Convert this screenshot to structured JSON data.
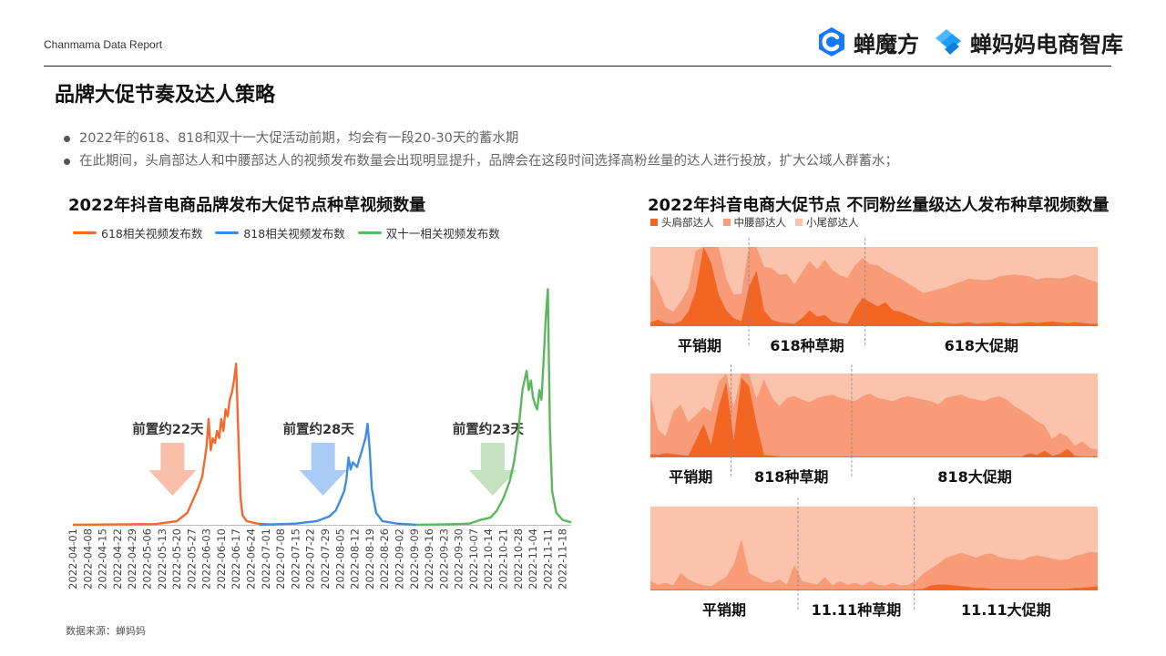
{
  "header": {
    "report_name": "Chanmama Data Report"
  },
  "logos": {
    "brand1": "蝉魔方",
    "brand2": "蝉妈妈电商智库",
    "brand1_color": "#1677ff",
    "brand2_color": "#1a9fff"
  },
  "page": {
    "title": "品牌大促节奏及达人策略"
  },
  "bullets": [
    "2022年的618、818和双十一大促活动前期，均会有一段20-30天的蓄水期",
    "在此期间，头肩部达人和中腰部达人的视频发布数量会出现明显提升，品牌会在这段时间选择高粉丝量的达人进行投放，扩大公域人群蓄水；"
  ],
  "source": "数据来源：蝉妈妈",
  "chart_data": [
    {
      "type": "line",
      "title": "2022年抖音电商品牌发布大促节点种草视频数量",
      "x_tick_labels": [
        "2022-04-01",
        "2022-04-08",
        "2022-04-15",
        "2022-04-22",
        "2022-04-29",
        "2022-05-06",
        "2022-05-13",
        "2022-05-20",
        "2022-05-27",
        "2022-06-03",
        "2022-06-10",
        "2022-06-17",
        "2022-06-24",
        "2022-07-01",
        "2022-07-08",
        "2022-07-15",
        "2022-07-22",
        "2022-07-29",
        "2022-08-05",
        "2022-08-12",
        "2022-08-19",
        "2022-08-26",
        "2022-09-02",
        "2022-09-09",
        "2022-09-16",
        "2022-09-23",
        "2022-09-30",
        "2022-10-07",
        "2022-10-14",
        "2022-10-21",
        "2022-10-28",
        "2022-11-04",
        "2022-11-11",
        "2022-11-18"
      ],
      "x_range": [
        "2022-04-01",
        "2022-11-22"
      ],
      "y_range": [
        0,
        100
      ],
      "series": [
        {
          "name": "618相关视频发布数",
          "color": "#f26b2e",
          "points": [
            [
              "2022-04-01",
              0
            ],
            [
              "2022-05-10",
              0.3
            ],
            [
              "2022-05-20",
              1.5
            ],
            [
              "2022-05-25",
              5
            ],
            [
              "2022-05-30",
              15
            ],
            [
              "2022-06-01",
              20
            ],
            [
              "2022-06-03",
              32
            ],
            [
              "2022-06-04",
              44
            ],
            [
              "2022-06-05",
              31
            ],
            [
              "2022-06-06",
              36
            ],
            [
              "2022-06-07",
              34
            ],
            [
              "2022-06-08",
              39
            ],
            [
              "2022-06-09",
              36
            ],
            [
              "2022-06-10",
              44
            ],
            [
              "2022-06-11",
              39
            ],
            [
              "2022-06-12",
              48
            ],
            [
              "2022-06-13",
              45
            ],
            [
              "2022-06-14",
              52
            ],
            [
              "2022-06-15",
              55
            ],
            [
              "2022-06-16",
              60
            ],
            [
              "2022-06-17",
              67
            ],
            [
              "2022-06-18",
              38
            ],
            [
              "2022-06-19",
              12
            ],
            [
              "2022-06-20",
              4
            ],
            [
              "2022-06-22",
              1.5
            ],
            [
              "2022-06-27",
              0.5
            ],
            [
              "2022-07-05",
              0
            ]
          ]
        },
        {
          "name": "818相关视频发布数",
          "color": "#3d8ee0",
          "points": [
            [
              "2022-06-28",
              0
            ],
            [
              "2022-07-15",
              0.5
            ],
            [
              "2022-07-25",
              1.5
            ],
            [
              "2022-07-31",
              3.5
            ],
            [
              "2022-08-03",
              6
            ],
            [
              "2022-08-05",
              10
            ],
            [
              "2022-08-07",
              14
            ],
            [
              "2022-08-08",
              19
            ],
            [
              "2022-08-09",
              28
            ],
            [
              "2022-08-10",
              23
            ],
            [
              "2022-08-11",
              26
            ],
            [
              "2022-08-13",
              24
            ],
            [
              "2022-08-15",
              30
            ],
            [
              "2022-08-17",
              36
            ],
            [
              "2022-08-18",
              42
            ],
            [
              "2022-08-19",
              31
            ],
            [
              "2022-08-20",
              15
            ],
            [
              "2022-08-22",
              5
            ],
            [
              "2022-08-25",
              1.5
            ],
            [
              "2022-09-01",
              0.5
            ],
            [
              "2022-09-10",
              0
            ]
          ]
        },
        {
          "name": "双十一相关视频发布数",
          "color": "#5cb85c",
          "points": [
            [
              "2022-09-10",
              0
            ],
            [
              "2022-09-25",
              0.2
            ],
            [
              "2022-10-05",
              0.5
            ],
            [
              "2022-10-10",
              2
            ],
            [
              "2022-10-15",
              3
            ],
            [
              "2022-10-18",
              6
            ],
            [
              "2022-10-21",
              11
            ],
            [
              "2022-10-24",
              18
            ],
            [
              "2022-10-26",
              26
            ],
            [
              "2022-10-28",
              38
            ],
            [
              "2022-10-30",
              56
            ],
            [
              "2022-11-01",
              64
            ],
            [
              "2022-11-02",
              56
            ],
            [
              "2022-11-03",
              60
            ],
            [
              "2022-11-04",
              53
            ],
            [
              "2022-11-05",
              50
            ],
            [
              "2022-11-06",
              48
            ],
            [
              "2022-11-07",
              56
            ],
            [
              "2022-11-08",
              52
            ],
            [
              "2022-11-09",
              68
            ],
            [
              "2022-11-10",
              86
            ],
            [
              "2022-11-11",
              98
            ],
            [
              "2022-11-12",
              40
            ],
            [
              "2022-11-13",
              14
            ],
            [
              "2022-11-15",
              5
            ],
            [
              "2022-11-18",
              2
            ],
            [
              "2022-11-22",
              1
            ]
          ]
        }
      ],
      "annotations": [
        {
          "text": "前置约22天",
          "arrow_color": "#f8c0a8",
          "x": "2022-05-18"
        },
        {
          "text": "前置约28天",
          "arrow_color": "#a8ccf5",
          "x": "2022-07-28"
        },
        {
          "text": "前置约23天",
          "arrow_color": "#c3e2bd",
          "x": "2022-10-16"
        }
      ],
      "legend_position": "top-left",
      "grid": false
    },
    {
      "type": "area",
      "stacking": "100%",
      "title": "2022年抖音电商大促节点 不同粉丝量级达人发布种草视频数量",
      "legend": [
        {
          "name": "头肩部达人",
          "color": "#f26522"
        },
        {
          "name": "中腰部达人",
          "color": "#f79b78"
        },
        {
          "name": "小尾部达人",
          "color": "#fbc3ac"
        }
      ],
      "panels": [
        {
          "phases": [
            "平销期",
            "618种草期",
            "618大促期"
          ],
          "divider_fractions": [
            0.22,
            0.48
          ],
          "head": [
            5,
            8,
            4,
            3,
            6,
            18,
            45,
            100,
            80,
            40,
            20,
            10,
            6,
            50,
            70,
            20,
            8,
            5,
            4,
            3,
            10,
            20,
            12,
            14,
            6,
            4,
            3,
            22,
            36,
            30,
            25,
            30,
            20,
            18,
            14,
            10,
            6,
            4,
            5,
            4,
            3,
            4,
            5,
            3,
            4,
            4,
            5,
            4,
            3,
            4,
            5,
            4,
            5,
            6,
            5,
            4,
            5,
            4,
            3,
            3
          ],
          "mid": [
            60,
            40,
            20,
            15,
            25,
            30,
            50,
            40,
            60,
            70,
            40,
            30,
            35,
            50,
            45,
            55,
            65,
            60,
            62,
            50,
            58,
            62,
            60,
            70,
            65,
            60,
            58,
            55,
            50,
            48,
            52,
            40,
            45,
            42,
            40,
            38,
            36,
            40,
            42,
            45,
            50,
            52,
            55,
            56,
            54,
            55,
            58,
            60,
            62,
            60,
            58,
            55,
            56,
            55,
            55,
            58,
            60,
            58,
            55,
            52
          ]
        },
        {
          "phases": [
            "平销期",
            "818种草期",
            "818大促期"
          ],
          "divider_fractions": [
            0.18,
            0.45
          ],
          "head": [
            4,
            3,
            5,
            4,
            3,
            2,
            20,
            40,
            15,
            60,
            90,
            20,
            95,
            85,
            40,
            3,
            2,
            1,
            1,
            1,
            1,
            1,
            1,
            1,
            1,
            1,
            1,
            1,
            1,
            1,
            1,
            1,
            1,
            1,
            1,
            1,
            1,
            1,
            1,
            1,
            1,
            1,
            1,
            1,
            1,
            1,
            1,
            1,
            1,
            1,
            5,
            3,
            8,
            2,
            4,
            10,
            2,
            1,
            1,
            1
          ],
          "mid": [
            70,
            30,
            20,
            50,
            60,
            40,
            30,
            20,
            40,
            30,
            20,
            40,
            30,
            20,
            30,
            90,
            70,
            60,
            70,
            72,
            68,
            65,
            70,
            72,
            74,
            70,
            68,
            66,
            72,
            75,
            70,
            68,
            66,
            70,
            72,
            70,
            68,
            66,
            62,
            70,
            72,
            74,
            70,
            68,
            66,
            70,
            72,
            68,
            60,
            55,
            45,
            40,
            30,
            20,
            25,
            15,
            12,
            18,
            10,
            8
          ]
        },
        {
          "phases": [
            "平销期",
            "11.11种草期",
            "11.11大促期"
          ],
          "divider_fractions": [
            0.33,
            0.59
          ],
          "head": [
            1,
            1,
            1,
            1,
            1,
            1,
            1,
            1,
            1,
            1,
            1,
            1,
            1,
            1,
            1,
            1,
            1,
            1,
            1,
            1,
            1,
            1,
            1,
            1,
            1,
            1,
            1,
            1,
            1,
            1,
            1,
            1,
            1,
            1,
            1,
            1,
            2,
            6,
            7,
            7,
            6,
            5,
            4,
            3,
            3,
            2,
            2,
            2,
            2,
            2,
            2,
            2,
            2,
            2,
            2,
            2,
            3,
            3,
            4,
            5
          ],
          "mid": [
            10,
            6,
            8,
            5,
            20,
            12,
            8,
            5,
            4,
            10,
            15,
            30,
            60,
            20,
            15,
            10,
            8,
            12,
            6,
            30,
            10,
            8,
            6,
            15,
            5,
            10,
            6,
            8,
            5,
            10,
            6,
            5,
            8,
            5,
            6,
            10,
            18,
            20,
            25,
            32,
            36,
            40,
            38,
            36,
            40,
            42,
            38,
            36,
            35,
            34,
            38,
            40,
            38,
            36,
            34,
            35,
            38,
            40,
            42,
            40
          ]
        }
      ]
    }
  ]
}
